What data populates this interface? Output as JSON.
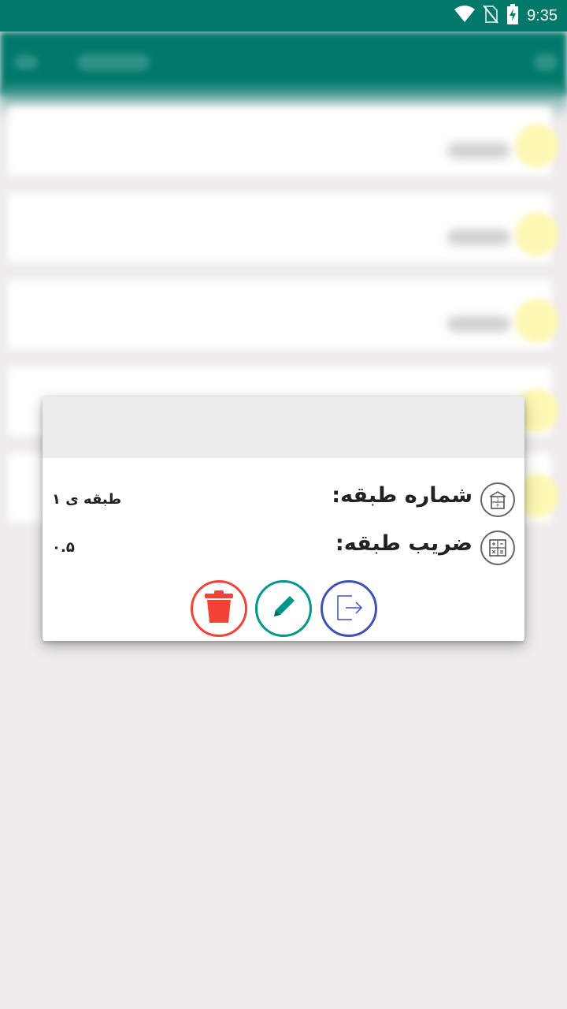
{
  "status_bar": {
    "time": "9:35",
    "icons": [
      "wifi-icon",
      "no-sim-icon",
      "battery-charging-icon"
    ]
  },
  "dialog": {
    "rows": [
      {
        "label": "شماره طبقه:",
        "value": "طبقه ی ۱",
        "icon": "floor-number-icon"
      },
      {
        "label": "ضریب طبقه:",
        "value": "۰.۵",
        "icon": "calculator-icon"
      }
    ],
    "actions": [
      {
        "name": "delete",
        "icon": "trash-icon",
        "color": "#f44336"
      },
      {
        "name": "edit",
        "icon": "pencil-icon",
        "color": "#009688"
      },
      {
        "name": "enter",
        "icon": "enter-icon",
        "color": "#3f51b5"
      }
    ]
  },
  "colors": {
    "primary": "#00796b",
    "background": "#efebee",
    "delete": "#f44336",
    "edit": "#009688",
    "enter": "#3f51b5"
  }
}
